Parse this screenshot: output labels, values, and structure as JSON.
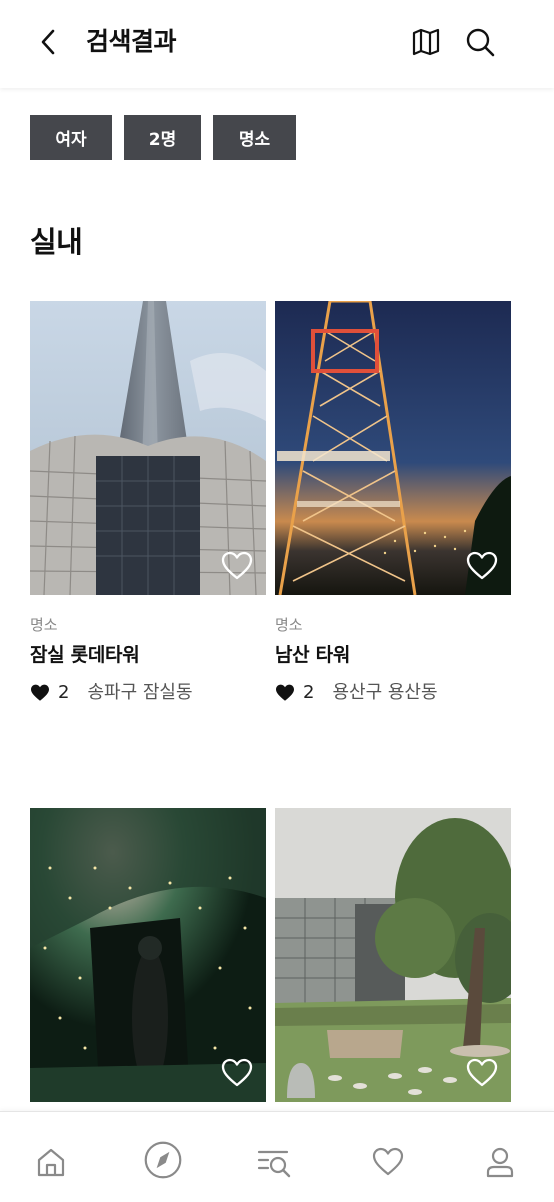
{
  "header": {
    "title": "검색결과",
    "back_icon": "chevron-left-icon",
    "map_icon": "map-icon",
    "search_icon": "search-icon"
  },
  "filters": [
    {
      "label": "여자"
    },
    {
      "label": "2명"
    },
    {
      "label": "명소"
    }
  ],
  "section": {
    "title": "실내"
  },
  "places": [
    {
      "category": "명소",
      "name": "잠실 롯데타워",
      "likes": "2",
      "location": "송파구 잠실동",
      "image": "lotte-world-tower-photo"
    },
    {
      "category": "명소",
      "name": "남산 타워",
      "likes": "2",
      "location": "용산구 용산동",
      "image": "namsan-tower-photo"
    },
    {
      "category": "",
      "name": "",
      "likes": "",
      "location": "",
      "image": "illuminated-tunnel-photo"
    },
    {
      "category": "",
      "name": "",
      "likes": "",
      "location": "",
      "image": "museum-garden-tree-photo"
    }
  ],
  "tabbar": {
    "items": [
      {
        "icon": "home-icon"
      },
      {
        "icon": "compass-icon"
      },
      {
        "icon": "search-list-icon"
      },
      {
        "icon": "heart-icon"
      },
      {
        "icon": "profile-icon"
      }
    ]
  },
  "colors": {
    "chip_bg": "#45474c",
    "text_primary": "#111111",
    "text_muted": "#8a8a8a",
    "icon_gray": "#8a8a8a"
  }
}
